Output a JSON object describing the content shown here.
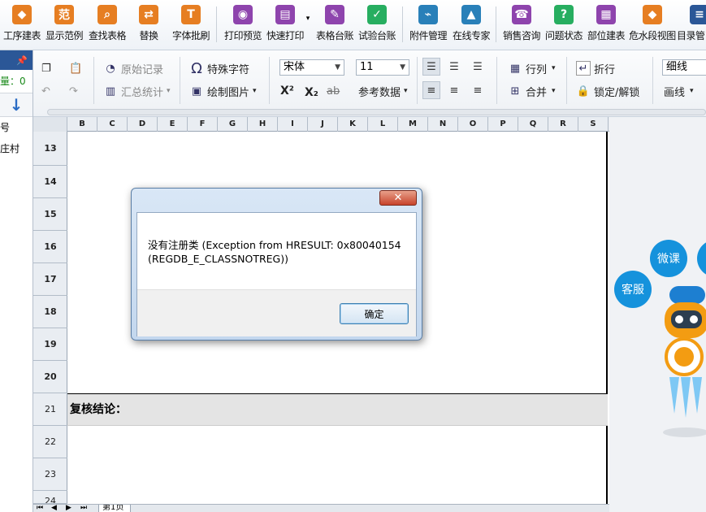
{
  "ribbon": [
    {
      "label": "工序建表",
      "icon": "layers-icon",
      "glyph": "◆",
      "color": "#e67e22"
    },
    {
      "label": "显示范例",
      "icon": "example-icon",
      "glyph": "范",
      "color": "#e67e22"
    },
    {
      "label": "查找表格",
      "icon": "search-icon",
      "glyph": "⌕",
      "color": "#e67e22"
    },
    {
      "label": "替换",
      "icon": "replace-icon",
      "glyph": "⇄",
      "color": "#e67e22"
    },
    {
      "label": "字体批刷",
      "icon": "font-brush-icon",
      "glyph": "T",
      "color": "#e67e22"
    },
    {
      "label": "打印预览",
      "icon": "eye-icon",
      "glyph": "◉",
      "color": "#8e44ad"
    },
    {
      "label": "快速打印",
      "icon": "printer-icon",
      "glyph": "▤",
      "color": "#8e44ad"
    },
    {
      "label": "表格台账",
      "icon": "ledger-icon",
      "glyph": "✎",
      "color": "#8e44ad"
    },
    {
      "label": "试验台账",
      "icon": "test-ledger-icon",
      "glyph": "✓",
      "color": "#27ae60"
    },
    {
      "label": "附件管理",
      "icon": "paperclip-icon",
      "glyph": "⌁",
      "color": "#2980b9"
    },
    {
      "label": "在线专家",
      "icon": "graduation-cap-icon",
      "glyph": "▲",
      "color": "#2980b9"
    },
    {
      "label": "销售咨询",
      "icon": "headset-icon",
      "glyph": "☎",
      "color": "#8e44ad"
    },
    {
      "label": "问题状态",
      "icon": "question-icon",
      "glyph": "?",
      "color": "#27ae60"
    },
    {
      "label": "部位建表",
      "icon": "grid-icon",
      "glyph": "▦",
      "color": "#8e44ad"
    },
    {
      "label": "危水段视图",
      "icon": "layers-orange-icon",
      "glyph": "◆",
      "color": "#e67e22"
    },
    {
      "label": "目录管",
      "icon": "directory-icon",
      "glyph": "≡",
      "color": "#2b5797"
    }
  ],
  "left_panel": {
    "pin": "📌",
    "quantity": "量：0",
    "items": [
      "号",
      "庄村"
    ]
  },
  "toolbar": {
    "original_record": "原始记录",
    "summary_stats": "汇总统计",
    "special_chars": "特殊字符",
    "draw_picture": "绘制图片",
    "font_name": "宋体",
    "font_size": "11",
    "superscript": "X²",
    "subscript": "X₂",
    "strikethrough": "ab",
    "reference_data": "参考数据",
    "row_col": "行列",
    "merge": "合并",
    "wrap": "折行",
    "lock_unlock": "锁定/解锁",
    "line_style": "细线",
    "draw_line": "画线"
  },
  "sheet": {
    "columns": [
      "B",
      "C",
      "D",
      "E",
      "F",
      "G",
      "H",
      "I",
      "J",
      "K",
      "L",
      "M",
      "N",
      "O",
      "P",
      "Q",
      "R",
      "S"
    ],
    "rows": [
      "13",
      "14",
      "15",
      "16",
      "17",
      "18",
      "19",
      "20",
      "21",
      "22",
      "23",
      "24"
    ],
    "row21_text": "复核结论：",
    "tab_label": "第1页"
  },
  "right_panel": {
    "bubble_micro_course": "微课",
    "bubble_service": "客服"
  },
  "dialog": {
    "message": "没有注册类 (Exception from HRESULT: 0x80040154 (REGDB_E_CLASSNOTREG))",
    "ok_label": "确定",
    "close_glyph": "✕"
  }
}
